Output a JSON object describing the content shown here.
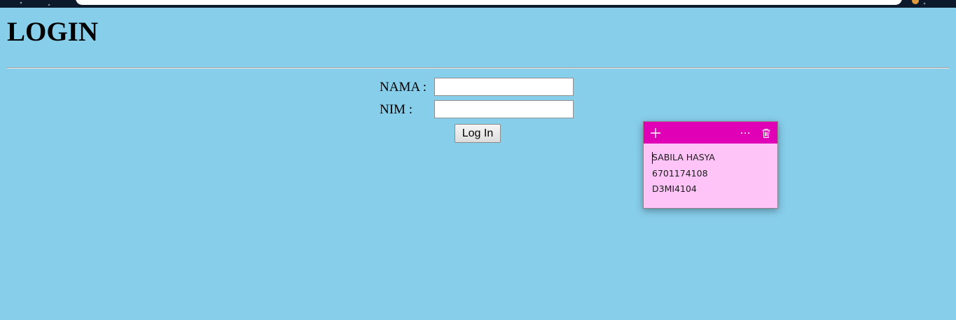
{
  "page": {
    "title": "LOGIN"
  },
  "form": {
    "nama_label": "NAMA :",
    "nama_value": "",
    "nim_label": "NIM :",
    "nim_value": "",
    "submit_label": "Log In"
  },
  "sticky_note": {
    "header_color": "#e000b6",
    "body_color": "#ffc4f7",
    "icons": [
      "plus-icon",
      "more-icon",
      "trash-icon"
    ],
    "lines": [
      "SABILA HASYA",
      "6701174108",
      "D3MI4104"
    ]
  },
  "colors": {
    "page_background": "#87ceeb"
  }
}
